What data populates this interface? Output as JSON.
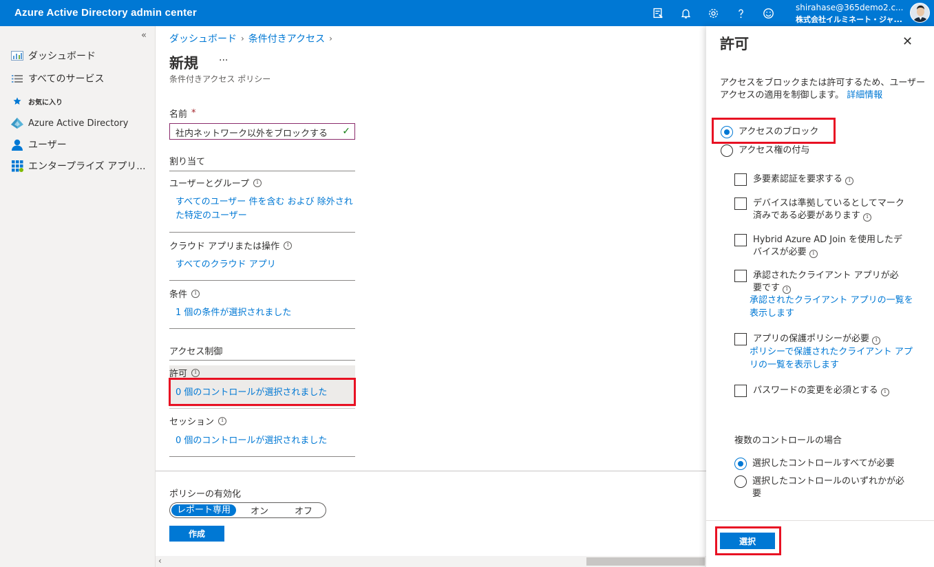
{
  "header": {
    "title": "Azure Active Directory admin center",
    "user_email": "shirahase@365demo2.c...",
    "user_org": "株式会社イルミネート・ジャ...",
    "icons": [
      "feedback-icon",
      "bell-icon",
      "gear-icon",
      "help-icon",
      "smiley-icon"
    ]
  },
  "sidebar": {
    "collapse": "«",
    "items": [
      {
        "label": "ダッシュボード",
        "icon": "dashboard-icon"
      },
      {
        "label": "すべてのサービス",
        "icon": "list-icon"
      },
      {
        "label": "お気に入り",
        "icon": "star-icon"
      },
      {
        "label": "Azure Active Directory",
        "icon": "aad-icon"
      },
      {
        "label": "ユーザー",
        "icon": "user-icon"
      },
      {
        "label": "エンタープライズ アプリ...",
        "icon": "apps-icon"
      }
    ]
  },
  "breadcrumb": [
    "ダッシュボード",
    "条件付きアクセス"
  ],
  "page": {
    "title": "新規",
    "more": "···",
    "subtitle": "条件付きアクセス ポリシー"
  },
  "form": {
    "name_label": "名前",
    "name_required": "*",
    "name_value": "社内ネットワーク以外をブロックする",
    "assignments_heading": "割り当て",
    "users_label": "ユーザーとグループ",
    "users_link_line1": "すべてのユーザー 件を含む および 除外され",
    "users_link_line2": "た特定のユーザー",
    "apps_label": "クラウド アプリまたは操作",
    "apps_link": "すべてのクラウド アプリ",
    "conditions_label": "条件",
    "conditions_link": "1 個の条件が選択されました",
    "access_heading": "アクセス制御",
    "grant_label": "許可",
    "grant_link": "0 個のコントロールが選択されました",
    "session_label": "セッション",
    "session_link": "0 個のコントロールが選択されました",
    "enable_label": "ポリシーの有効化",
    "toggle_options": [
      "レポート専用",
      "オン",
      "オフ"
    ],
    "toggle_selected": "レポート専用",
    "create_button": "作成"
  },
  "panel": {
    "title": "許可",
    "close": "✕",
    "desc": "アクセスをブロックまたは許可するため、ユーザー アクセスの適用を制御します。",
    "desc_link": "詳細情報",
    "radio_block": "アクセスのブロック",
    "radio_grant": "アクセス権の付与",
    "radio_selected": "アクセスのブロック",
    "checkboxes": [
      {
        "label": "多要素認証を要求する"
      },
      {
        "label": "デバイスは準拠しているとしてマーク済みである必要があります"
      },
      {
        "label": "Hybrid Azure AD Join を使用したデバイスが必要"
      },
      {
        "label": "承認されたクライアント アプリが必要です",
        "link": "承認されたクライアント アプリの一覧を表示します"
      },
      {
        "label": "アプリの保護ポリシーが必要",
        "link": "ポリシーで保護されたクライアント アプリの一覧を表示します"
      },
      {
        "label": "パスワードの変更を必須とする"
      }
    ],
    "multi_heading": "複数のコントロールの場合",
    "multi_all": "選択したコントロールすべてが必要",
    "multi_any": "選択したコントロールのいずれかが必要",
    "multi_selected": "選択したコントロールすべてが必要",
    "select_button": "選択"
  },
  "colors": {
    "brand": "#0078d4",
    "highlight": "#e81123",
    "input_border": "#8a2a6b"
  }
}
